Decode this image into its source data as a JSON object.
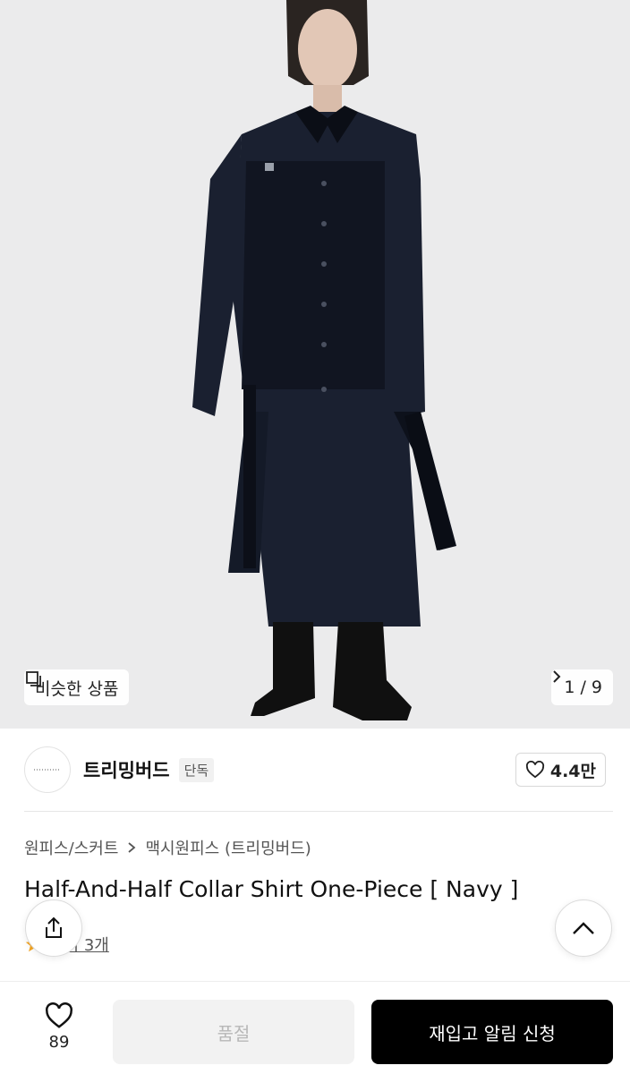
{
  "gallery": {
    "similar_label": "비슷한 상품",
    "counter": "1 / 9"
  },
  "brand": {
    "name": "트리밍버드",
    "badge": "단독",
    "likes": "4.4만"
  },
  "breadcrumb": {
    "level1": "원피스/스커트",
    "level2": "맥시원피스 (트리밍버드)"
  },
  "product": {
    "title": "Half-And-Half Collar Shirt One-Piece [ Navy ]",
    "review_text": "후기 3개"
  },
  "bottom_bar": {
    "wish_count": "89",
    "soldout_label": "품절",
    "restock_label": "재입고 알림 신청"
  },
  "colors": {
    "accent_star": "#f5a623",
    "dress_navy": "#161c2b",
    "primary_button": "#000000"
  }
}
